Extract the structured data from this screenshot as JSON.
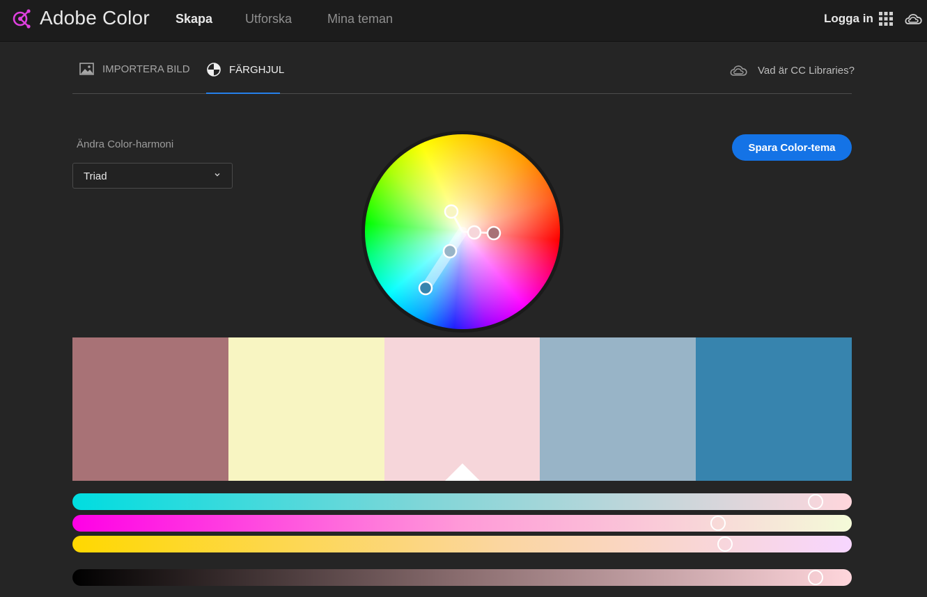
{
  "header": {
    "brand": "Adobe Color",
    "nav": [
      {
        "label": "Skapa",
        "active": true
      },
      {
        "label": "Utforska",
        "active": false
      },
      {
        "label": "Mina teman",
        "active": false
      }
    ],
    "login": "Logga in",
    "icons": [
      "adobe-color-logo-icon",
      "apps-grid-icon",
      "creative-cloud-icon"
    ]
  },
  "tabs": [
    {
      "label": "IMPORTERA BILD",
      "icon": "image-icon",
      "active": false
    },
    {
      "label": "FÄRGHJUL",
      "icon": "color-wheel-icon",
      "active": true
    }
  ],
  "cc_libraries_link": "Vad är CC Libraries?",
  "harmony": {
    "label": "Ändra Color-harmoni",
    "selected": "Triad"
  },
  "save_button": "Spara Color-tema",
  "swatches": [
    {
      "color": "#a87276"
    },
    {
      "color": "#f8f5c2"
    },
    {
      "color": "#f6d6da",
      "selected": true
    },
    {
      "color": "#98b4c7"
    },
    {
      "color": "#3784ae"
    }
  ],
  "sliders": [
    {
      "name": "cyan",
      "value": 0.963
    },
    {
      "name": "magenta",
      "value": 0.835
    },
    {
      "name": "yellow",
      "value": 0.844
    },
    {
      "name": "black",
      "value": 0.963
    }
  ],
  "colors": {
    "accent": "#2680eb",
    "button": "#1473e6",
    "background": "#252525",
    "topbar": "#1c1c1c"
  }
}
